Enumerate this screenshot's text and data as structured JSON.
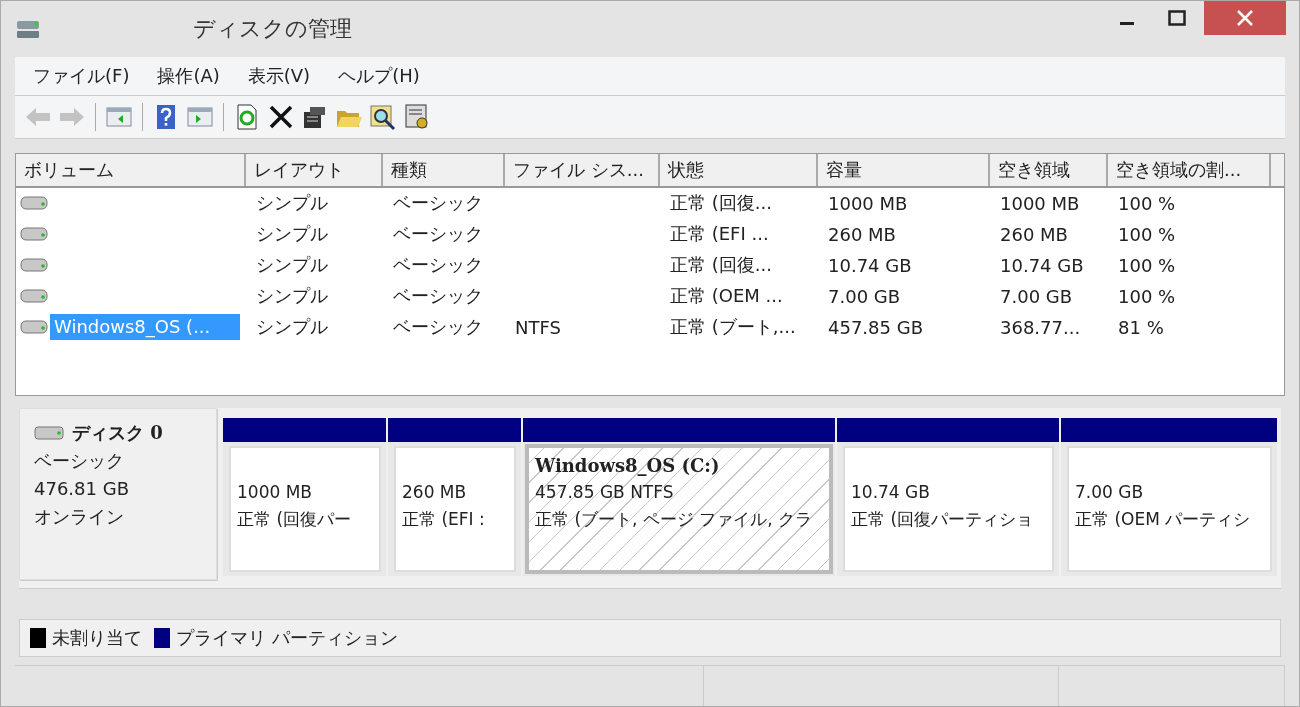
{
  "window": {
    "title": "ディスクの管理"
  },
  "menu": [
    "ファイル(F)",
    "操作(A)",
    "表示(V)",
    "ヘルプ(H)"
  ],
  "toolbar": [
    [
      {
        "kind": "back",
        "disabled": true
      },
      {
        "kind": "forward",
        "disabled": true
      }
    ],
    [
      {
        "kind": "tree",
        "disabled": false
      }
    ],
    [
      {
        "kind": "help",
        "disabled": false
      },
      {
        "kind": "pane",
        "disabled": false
      }
    ],
    [
      {
        "kind": "refresh",
        "disabled": false
      },
      {
        "kind": "delete",
        "disabled": false
      },
      {
        "kind": "properties",
        "disabled": false
      },
      {
        "kind": "open",
        "disabled": false
      },
      {
        "kind": "search",
        "disabled": false
      },
      {
        "kind": "settings",
        "disabled": false
      }
    ]
  ],
  "table": {
    "columns": [
      "ボリューム",
      "レイアウト",
      "種類",
      "ファイル シス...",
      "状態",
      "容量",
      "空き領域",
      "空き領域の割..."
    ],
    "rows": [
      {
        "selected": false,
        "cells": [
          "",
          "シンプル",
          "ベーシック",
          "",
          "正常 (回復...",
          "1000 MB",
          "1000 MB",
          "100 %"
        ]
      },
      {
        "selected": false,
        "cells": [
          "",
          "シンプル",
          "ベーシック",
          "",
          "正常 (EFI ...",
          "260 MB",
          "260 MB",
          "100 %"
        ]
      },
      {
        "selected": false,
        "cells": [
          "",
          "シンプル",
          "ベーシック",
          "",
          "正常 (回復...",
          "10.74 GB",
          "10.74 GB",
          "100 %"
        ]
      },
      {
        "selected": false,
        "cells": [
          "",
          "シンプル",
          "ベーシック",
          "",
          "正常 (OEM ...",
          "7.00 GB",
          "7.00 GB",
          "100 %"
        ]
      },
      {
        "selected": true,
        "cells": [
          "Windows8_OS (...",
          "シンプル",
          "ベーシック",
          "NTFS",
          "正常 (ブート,...",
          "457.85 GB",
          "368.77...",
          "81 %"
        ]
      }
    ]
  },
  "disk": {
    "name": "ディスク 0",
    "type": "ベーシック",
    "size": "476.81 GB",
    "status": "オンライン",
    "partitions": [
      {
        "selected": false,
        "color": "#000080",
        "lines": [
          "1000 MB",
          "正常 (回復パー"
        ]
      },
      {
        "selected": false,
        "color": "#000080",
        "lines": [
          "260 MB",
          "正常 (EFI :"
        ]
      },
      {
        "selected": true,
        "color": "#000080",
        "name": "Windows8_OS  (C:)",
        "lines": [
          "457.85 GB NTFS",
          "正常 (ブート, ページ ファイル, クラ"
        ]
      },
      {
        "selected": false,
        "color": "#000080",
        "lines": [
          "10.74 GB",
          "正常 (回復パーティショ"
        ]
      },
      {
        "selected": false,
        "color": "#000080",
        "lines": [
          "7.00 GB",
          "正常 (OEM パーティシ"
        ]
      }
    ]
  },
  "legend": [
    {
      "label": "未割り当て",
      "color": "#000000"
    },
    {
      "label": "プライマリ パーティション",
      "color": "#000080"
    }
  ]
}
